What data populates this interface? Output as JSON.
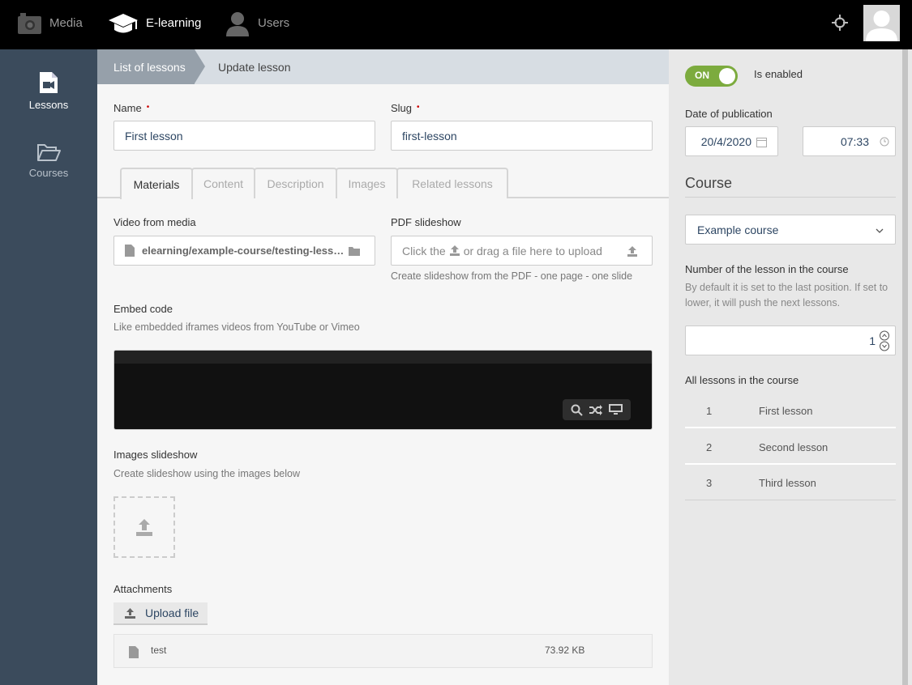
{
  "topnav": {
    "items": [
      {
        "label": "Media",
        "icon": "camera-icon"
      },
      {
        "label": "E-learning",
        "icon": "graduation-cap-icon"
      },
      {
        "label": "Users",
        "icon": "user-icon"
      }
    ]
  },
  "sidebar": {
    "items": [
      {
        "label": "Lessons",
        "icon": "video-file-icon"
      },
      {
        "label": "Courses",
        "icon": "folder-open-icon"
      }
    ]
  },
  "breadcrumb": {
    "parent": "List of lessons",
    "current": "Update lesson"
  },
  "form": {
    "name_label": "Name",
    "name_value": "First lesson",
    "slug_label": "Slug",
    "slug_value": "first-lesson",
    "required_mark": "•"
  },
  "tabs": [
    {
      "label": "Materials",
      "active": true
    },
    {
      "label": "Content",
      "active": false
    },
    {
      "label": "Description",
      "active": false
    },
    {
      "label": "Images",
      "active": false
    },
    {
      "label": "Related lessons",
      "active": false
    }
  ],
  "materials": {
    "video_label": "Video from media",
    "video_value": "elearning/example-course/testing-less…",
    "pdf_label": "PDF slideshow",
    "pdf_placeholder_before": "Click the",
    "pdf_placeholder_after": "or drag a file here to upload",
    "pdf_hint": "Create slideshow from the PDF - one page - one slide",
    "embed_label": "Embed code",
    "embed_hint": "Like embedded iframes videos from YouTube or Vimeo",
    "images_label": "Images slideshow",
    "images_hint": "Create slideshow using the images below",
    "attachments_label": "Attachments",
    "upload_button": "Upload file",
    "attachments": [
      {
        "name": "test",
        "size": "73.92 KB"
      }
    ]
  },
  "settings": {
    "toggle_state": "ON",
    "enabled_label": "Is enabled",
    "date_label": "Date of publication",
    "date_value": "20/4/2020",
    "time_value": "07:33",
    "course_heading": "Course",
    "course_selected": "Example course",
    "number_label": "Number of the lesson in the course",
    "number_hint": "By default it is set to the last position. If set to lower, it will push the next lessons.",
    "number_value": "1",
    "all_lessons_label": "All lessons in the course",
    "lessons": [
      {
        "num": "1",
        "name": "First lesson"
      },
      {
        "num": "2",
        "name": "Second lesson"
      },
      {
        "num": "3",
        "name": "Third lesson"
      }
    ]
  },
  "colors": {
    "topbar": "#000000",
    "sidebar": "#3b4b5c",
    "toggle_on": "#7cab3e",
    "link_text": "#2d4663"
  }
}
